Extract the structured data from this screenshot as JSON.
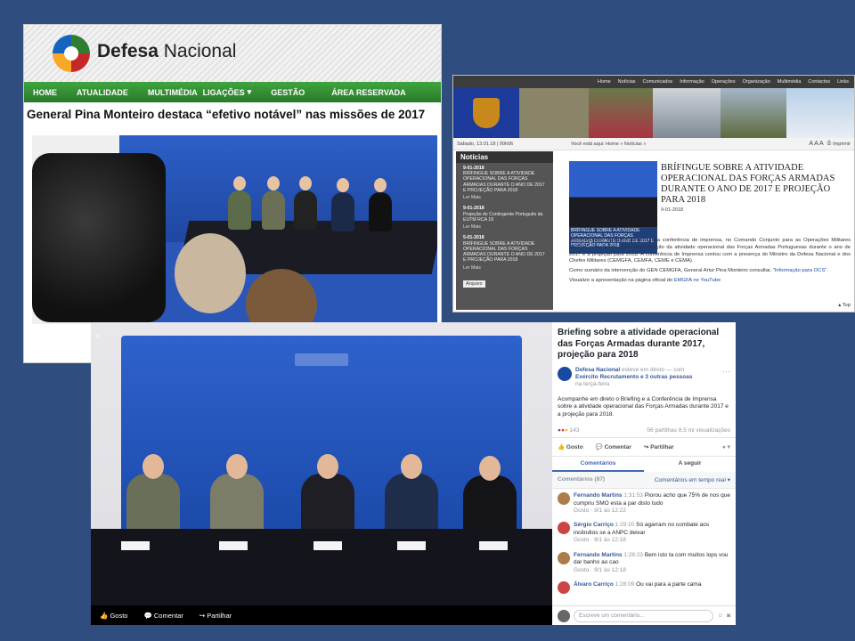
{
  "panel1": {
    "brand_bold": "Defesa",
    "brand_rest": "Nacional",
    "nav": [
      "HOME",
      "ATUALIDADE",
      "MULTIMÉDIA",
      "LIGAÇÕES",
      "GESTÃO",
      "ÁREA RESERVADA"
    ],
    "headline": "General Pina Monteiro destaca “efetivo notável” nas missões de 2017"
  },
  "panel2": {
    "topnav": [
      "Home",
      "Notícias",
      "Comunicados",
      "Informação",
      "Operações",
      "Organização",
      "Multimédia",
      "Contactos",
      "Links"
    ],
    "date": "Sábado, 13.01.18 | 00h06",
    "breadcrumb": "Você está aqui: Home » Notícias »",
    "font_size": "A A A",
    "print": "Imprimir",
    "sidebar_title": "Notícias",
    "news": [
      {
        "date": "9-01-2018",
        "text": "BRÍFINGUE SOBRE A ATIVIDADE OPERACIONAL DAS FORÇAS ARMADAS DURANTE O ANO DE 2017 E PROJEÇÃO PARA 2018",
        "more": "Ler Mais"
      },
      {
        "date": "9-01-2018",
        "text": "Projeção do Contingente Português da EUTM RCA 18",
        "more": "Ler Mais"
      },
      {
        "date": "5-01-2018",
        "text": "BRÍFINGUE SOBRE A ATIVIDADE OPERACIONAL DAS FORÇAS ARMADAS DURANTE O ANO DE 2017 E PROJEÇÃO PARA 2018",
        "more": "Ler Mais"
      }
    ],
    "archive": "Arquivo",
    "thumb_caption": "BRÍFINGUE SOBRE A ATIVIDADE OPERACIONAL DAS FORÇAS ARMADAS DURANTE O ANO DE 2017 E PROJEÇÃO PARA 2018",
    "headline": "BRÍFINGUE SOBRE A ATIVIDADE OPERACIONAL DAS FORÇAS ARMADAS DURANTE O ANO DE 2017 E PROJEÇÃO PARA 2018",
    "article_date": "9-01-2018",
    "body1": "Decorreu hoje, dia 9 de janeiro, uma conferência de imprensa, no Comando Conjunto para as Operações Militares (CCOM), em Oeiras, para apresentação da atividade operacional das Forças Armadas Portuguesas durante o ano de 2017 e a projeção para 2018. A conferência de Imprensa contou com a presença do Ministro da Defesa Nacional e dos Chefes Militares (CEMGFA, CEMFA, CEME e CEMA).",
    "body2_text": "Como sumário da intervenção do GEN CEMGFA, General Artur Pina Monteiro consultar, ",
    "body2_link": "\"Informação para OCS\".",
    "body3_text": "Visualize a apresentação na página oficial do ",
    "body3_link": "EMGFA no YouTube",
    "top": "Top"
  },
  "panel3": {
    "video_bar": [
      "Gosto",
      "Comentar",
      "Partilhar"
    ],
    "title": "Briefing sobre a atividade operacional das Forças Armadas durante 2017, projeção para 2018",
    "page_name": "Defesa Nacional",
    "status": "esteve em direto — com",
    "with_names": "Exército Recrutamento e 3 outras pessoas",
    "when": "na terça-feira",
    "description": "Acompanhe em direto o Briefing e a Conferência de Imprensa sobre a atividade operacional das Forças Armadas durante 2017 e a projeção para 2018.",
    "reactions": "143",
    "shares_views": "56 partilhas 8,5 mi visualizações",
    "actions": [
      "Gosto",
      "Comentar",
      "Partilhar"
    ],
    "tabs": [
      "Comentários",
      "A seguir"
    ],
    "comments_count": "Comentários (87)",
    "sort": "Comentários em tempo real ▾",
    "comments": [
      {
        "name": "Fernando Martins",
        "time": "1:31:53",
        "text": "Piorou acho que 75% de nos que cumpriu SMO esta a par disto tudo",
        "meta": "Gosto · 9/1 às 12:22",
        "color": "#b07b4a"
      },
      {
        "name": "Sérgio Carriço",
        "time": "1:29:20",
        "text": "Só agarram no combate aos incêndios se a ANPC deixar",
        "meta": "Gosto · 9/1 às 12:18",
        "color": "#c44"
      },
      {
        "name": "Fernando Martins",
        "time": "1:28:23",
        "text": "Bem isto ta com muitos lops vou dar banho ao cao",
        "meta": "Gosto · 9/1 às 12:18",
        "color": "#b07b4a"
      },
      {
        "name": "Álvaro Carriço",
        "time": "1:28:09",
        "text": "Ou vai para a parte cama",
        "meta": "",
        "color": "#c44"
      }
    ],
    "comment_placeholder": "Escreve um comentário..."
  }
}
